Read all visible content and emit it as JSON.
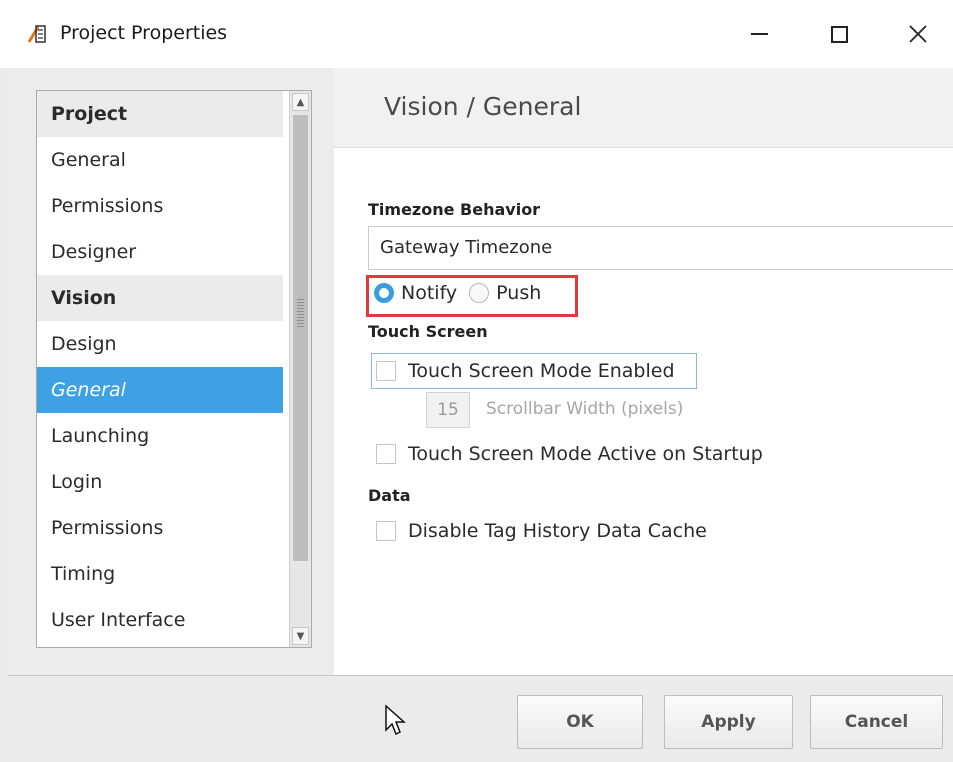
{
  "window": {
    "title": "Project Properties",
    "icon": "app-project-icon",
    "controls": [
      "minimize",
      "maximize",
      "close"
    ]
  },
  "sidebar": {
    "items": [
      {
        "label": "Project",
        "type": "header"
      },
      {
        "label": "General",
        "type": "item"
      },
      {
        "label": "Permissions",
        "type": "item"
      },
      {
        "label": "Designer",
        "type": "item"
      },
      {
        "label": "Vision",
        "type": "header"
      },
      {
        "label": "Design",
        "type": "item"
      },
      {
        "label": "General",
        "type": "item",
        "selected": true
      },
      {
        "label": "Launching",
        "type": "item"
      },
      {
        "label": "Login",
        "type": "item"
      },
      {
        "label": "Permissions",
        "type": "item"
      },
      {
        "label": "Timing",
        "type": "item"
      },
      {
        "label": "User Interface",
        "type": "item"
      }
    ]
  },
  "content": {
    "title": "Vision / General",
    "timezone": {
      "label": "Timezone Behavior",
      "value": "Gateway Timezone",
      "options": [
        {
          "label": "Notify",
          "checked": true
        },
        {
          "label": "Push",
          "checked": false
        }
      ]
    },
    "touch_screen": {
      "label": "Touch Screen",
      "mode_enabled": {
        "label": "Touch Screen Mode Enabled",
        "checked": false
      },
      "scrollbar_width": {
        "value": "15",
        "label": "Scrollbar Width (pixels)"
      },
      "active_on_startup": {
        "label": "Touch Screen Mode Active on Startup",
        "checked": false
      }
    },
    "data": {
      "label": "Data",
      "disable_cache": {
        "label": "Disable Tag History Data Cache",
        "checked": false
      }
    }
  },
  "footer": {
    "ok": "OK",
    "apply": "Apply",
    "cancel": "Cancel"
  },
  "colors": {
    "selection": "#3da1e3",
    "highlight": "#e0383e",
    "radio_accent": "#3b9de0"
  }
}
